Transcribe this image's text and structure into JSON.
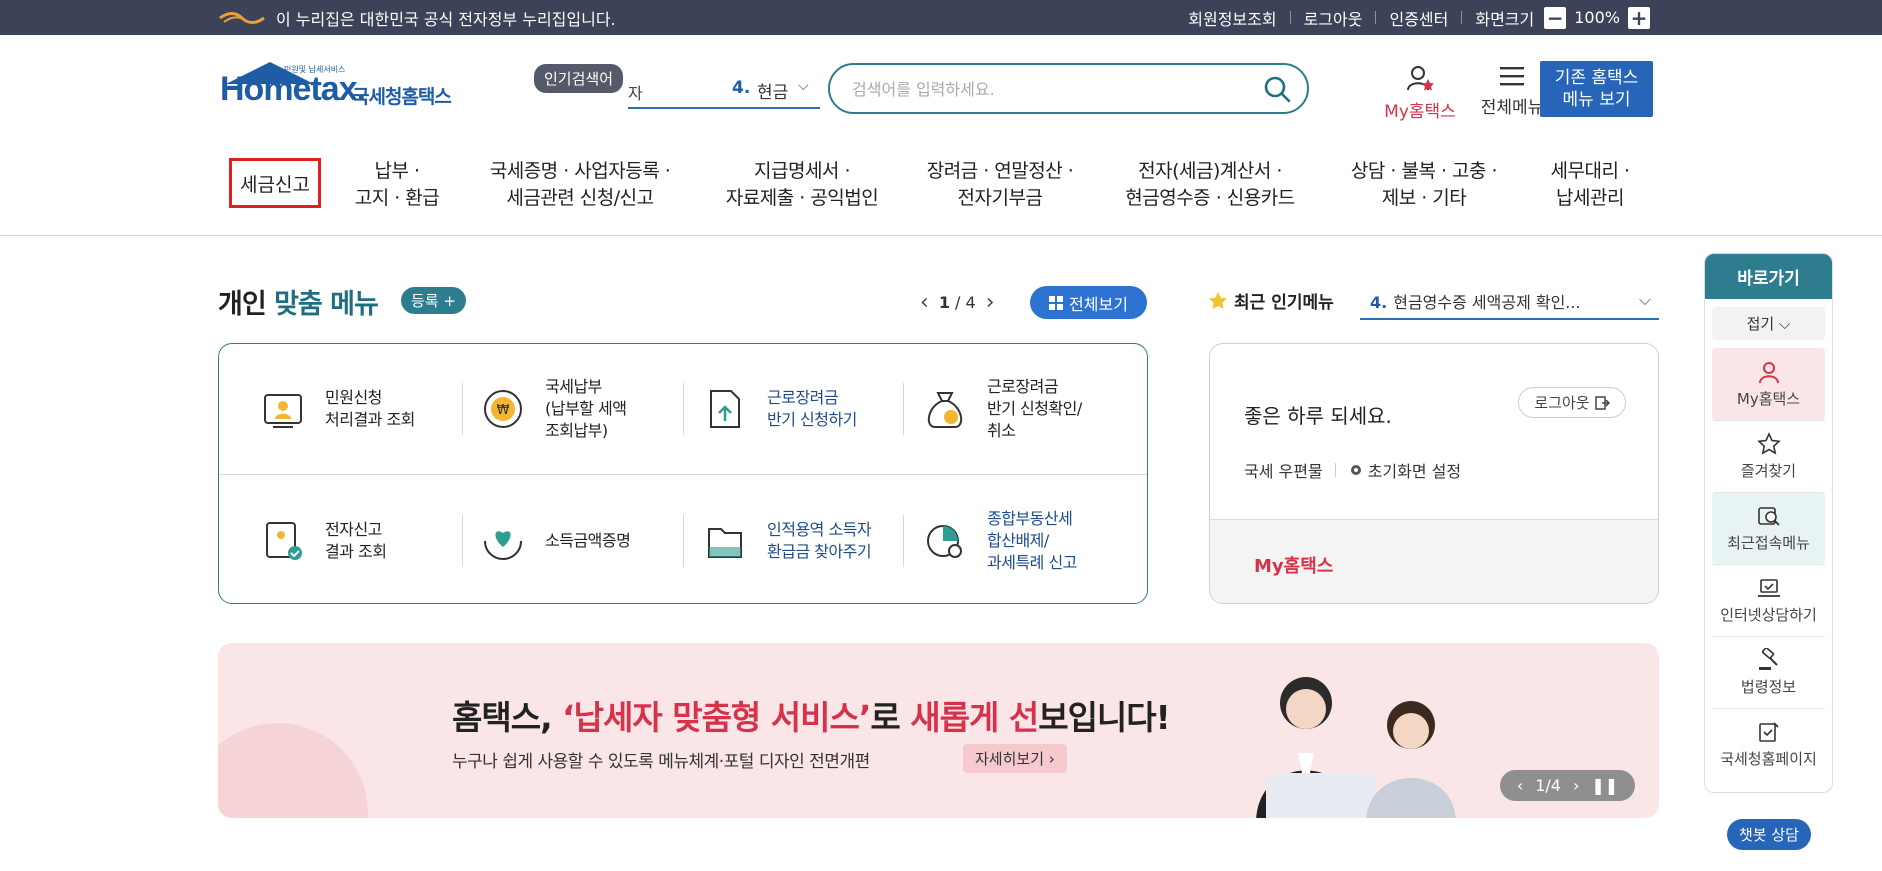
{
  "gov_bar": {
    "notice": "이 누리집은 대한민국 공식 전자정부 누리집입니다.",
    "links": [
      "회원정보조회",
      "로그아웃",
      "인증센터"
    ],
    "zoom_label": "화면크기",
    "zoom_minus": "−",
    "zoom_value": "100%",
    "zoom_plus": "+"
  },
  "header": {
    "logo_text": "Hometax.",
    "logo_sub": "국세청홈택스",
    "logo_tiny": "민원및 납세서비스",
    "popular_tag": "인기검색어",
    "popular_prev": "자",
    "popular_rank": "4.",
    "popular_word": "현금",
    "search_placeholder": "검색어를 입력하세요.",
    "my_hometax": "My홈택스",
    "all_menu": "전체메뉴",
    "old_menu_line1": "기존 홈택스",
    "old_menu_line2": "메뉴 보기"
  },
  "gnb": [
    {
      "label": "세금신고"
    },
    {
      "label": "납부 ·\n고지 · 환급"
    },
    {
      "label": "국세증명 · 사업자등록 ·\n세금관련 신청/신고"
    },
    {
      "label": "지급명세서 ·\n자료제출 · 공익법인"
    },
    {
      "label": "장려금 · 연말정산 ·\n전자기부금"
    },
    {
      "label": "전자(세금)계산서 ·\n현금영수증 · 신용카드"
    },
    {
      "label": "상담 · 불복 · 고충 ·\n제보 · 기타"
    },
    {
      "label": "세무대리 ·\n납세관리"
    }
  ],
  "personal": {
    "title_a": "개인",
    "title_b": "맞춤 메뉴",
    "register": "등록 +",
    "page_current": "1",
    "page_total": "/ 4",
    "view_all": "전체보기",
    "tiles": [
      {
        "label": "민원신청\n처리결과 조회",
        "icon": "document-person-icon",
        "blue": false
      },
      {
        "label": "국세납부\n(납부할 세액\n조회납부)",
        "icon": "won-coin-icon",
        "blue": false
      },
      {
        "label": "근로장려금\n반기 신청하기",
        "icon": "upload-document-icon",
        "blue": true
      },
      {
        "label": "근로장려금\n반기 신청확인/\n취소",
        "icon": "money-bag-icon",
        "blue": false
      },
      {
        "label": "전자신고\n결과 조회",
        "icon": "certificate-check-icon",
        "blue": false
      },
      {
        "label": "소득금액증명",
        "icon": "heart-hands-icon",
        "blue": false
      },
      {
        "label": "인적용역 소득자\n환급금 찾아주기",
        "icon": "folder-icon",
        "blue": true
      },
      {
        "label": "종합부동산세\n합산배제/\n과세특례 신고",
        "icon": "pie-search-icon",
        "blue": true
      }
    ]
  },
  "popular_menu": {
    "label": "최근 인기메뉴",
    "rank": "4.",
    "item": "현금영수증 세액공제 확인..."
  },
  "user_panel": {
    "greeting": "좋은 하루 되세요.",
    "logout": "로그아웃",
    "mail": "국세 우편물",
    "settings": "초기화면 설정",
    "my_hometax": "My홈택스"
  },
  "banner": {
    "line1_a": "홈택스, ",
    "line1_b": "‘납세자 맞춤형 서비스’",
    "line1_c": "로 ",
    "line1_d": "새롭게 선",
    "line1_e": "보입니다!",
    "line2": "누구나 쉽게 사용할 수 있도록 메뉴체계·포털 디자인 전면개편",
    "detail": "자세히보기",
    "pager": "1/4"
  },
  "quick_rail": {
    "title": "바로가기",
    "fold": "접기",
    "items": [
      "My홈택스",
      "즐겨찾기",
      "최근접속메뉴",
      "인터넷상담하기",
      "법령정보",
      "국세청홈페이지"
    ]
  },
  "chatbot": "챗봇 상담",
  "colors": {
    "teal": "#2d7d8f",
    "blue": "#2765b8",
    "red": "#d6334a",
    "gov_bar": "#3c4257"
  }
}
